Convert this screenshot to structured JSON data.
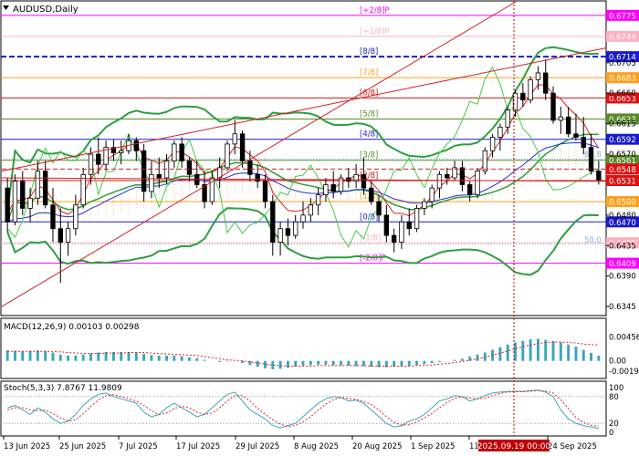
{
  "chart_data": {
    "type": "candlestick",
    "symbol_title": "AUDUSD,Daily",
    "ylim": [
      0.6333,
      0.6795
    ],
    "x_tick_labels": [
      "13 Jun 2025",
      "25 Jun 2025",
      "7 Jul 2025",
      "17 Jul 2025",
      "29 Jul 2025",
      "8 Aug 2025",
      "20 Aug 2025",
      "1 Sep 2025",
      "11 Sep 2025",
      "24 Sep 2025"
    ],
    "crosshair_label": "2025.09.19 00:00",
    "y_tick_labels": [
      {
        "text": "0.6705",
        "value": 0.6705
      },
      {
        "text": "0.6660",
        "value": 0.666
      },
      {
        "text": "0.6615",
        "value": 0.6615
      },
      {
        "text": "0.6570",
        "value": 0.657
      },
      {
        "text": "0.6480",
        "value": 0.648
      },
      {
        "text": "0.6435",
        "value": 0.6435
      },
      {
        "text": "0.6390",
        "value": 0.639
      },
      {
        "text": "0.6345",
        "value": 0.6345
      }
    ],
    "price_badges": [
      {
        "text": "0.6775",
        "value": 0.6775,
        "color": "#ff00ff"
      },
      {
        "text": "0.6744",
        "value": 0.6744,
        "color": "#ffb0c0"
      },
      {
        "text": "0.6714",
        "value": 0.6714,
        "color": "#1a1acc"
      },
      {
        "text": "0.6683",
        "value": 0.6683,
        "color": "#ff9f1a"
      },
      {
        "text": "0.6653",
        "value": 0.6653,
        "color": "#e01010"
      },
      {
        "text": "0.6622",
        "value": 0.6622,
        "color": "#5a8a2a"
      },
      {
        "text": "0.6592",
        "value": 0.6592,
        "color": "#1a1acc"
      },
      {
        "text": "0.6561",
        "value": 0.6561,
        "color": "#5a8a2a"
      },
      {
        "text": "0.6548",
        "value": 0.6548,
        "color": "#e01010"
      },
      {
        "text": "0.6531",
        "value": 0.6531,
        "color": "#e01010"
      },
      {
        "text": "0.6500",
        "value": 0.65,
        "color": "#ff9f1a"
      },
      {
        "text": "0.6470",
        "value": 0.647,
        "color": "#1a1acc"
      },
      {
        "text": "0.6439",
        "value": 0.6439,
        "color": "#ffb0c0"
      },
      {
        "text": "0.6409",
        "value": 0.6409,
        "color": "#ff00ff"
      }
    ],
    "murrey_levels": [
      {
        "label": "[+2/8]P",
        "value": 0.6775,
        "color": "#ff00ff"
      },
      {
        "label": "[+1/8]P",
        "value": 0.6744,
        "color": "#ffb0c0"
      },
      {
        "label": "[8/8]",
        "value": 0.6714,
        "color": "#1a1acc"
      },
      {
        "label": "[7/8]",
        "value": 0.6683,
        "color": "#ff9f1a"
      },
      {
        "label": "[6/8]",
        "value": 0.6653,
        "color": "#e01010"
      },
      {
        "label": "[5/8]",
        "value": 0.6622,
        "color": "#5a8a2a"
      },
      {
        "label": "[4/8]",
        "value": 0.6592,
        "color": "#1a1acc"
      },
      {
        "label": "[3/8]",
        "value": 0.6561,
        "color": "#5a8a2a"
      },
      {
        "label": "[2/8]",
        "value": 0.6531,
        "color": "#e01010"
      },
      {
        "label": "[1/8]",
        "value": 0.65,
        "color": "#ff9f1a"
      },
      {
        "label": "[0/8]",
        "value": 0.647,
        "color": "#1a1acc"
      },
      {
        "label": "[-1/8]",
        "value": 0.6439,
        "color": "#ffb0c0"
      },
      {
        "label": "[-2/8]P",
        "value": 0.6409,
        "color": "#ff00ff"
      }
    ],
    "fib_labels": [
      {
        "text": "61.8",
        "value": 0.6563
      },
      {
        "text": "50.0",
        "value": 0.6437
      }
    ],
    "candles": [
      [
        0.652,
        0.6535,
        0.6455,
        0.647
      ],
      [
        0.647,
        0.654,
        0.6465,
        0.653
      ],
      [
        0.653,
        0.6545,
        0.648,
        0.649
      ],
      [
        0.649,
        0.652,
        0.647,
        0.6505
      ],
      [
        0.6505,
        0.656,
        0.6495,
        0.6545
      ],
      [
        0.6545,
        0.656,
        0.649,
        0.6495
      ],
      [
        0.6495,
        0.652,
        0.644,
        0.646
      ],
      [
        0.646,
        0.649,
        0.638,
        0.644
      ],
      [
        0.644,
        0.647,
        0.642,
        0.646
      ],
      [
        0.646,
        0.651,
        0.645,
        0.6495
      ],
      [
        0.6495,
        0.655,
        0.649,
        0.654
      ],
      [
        0.654,
        0.658,
        0.6525,
        0.657
      ],
      [
        0.657,
        0.6595,
        0.654,
        0.6555
      ],
      [
        0.6555,
        0.659,
        0.6545,
        0.658
      ],
      [
        0.658,
        0.6592,
        0.656,
        0.6572
      ],
      [
        0.6572,
        0.659,
        0.6555,
        0.6575
      ],
      [
        0.6575,
        0.66,
        0.657,
        0.659
      ],
      [
        0.659,
        0.6595,
        0.656,
        0.6575
      ],
      [
        0.6575,
        0.6585,
        0.65,
        0.6515
      ],
      [
        0.6515,
        0.656,
        0.6505,
        0.654
      ],
      [
        0.654,
        0.6565,
        0.652,
        0.6535
      ],
      [
        0.6535,
        0.657,
        0.6525,
        0.656
      ],
      [
        0.656,
        0.659,
        0.655,
        0.6585
      ],
      [
        0.6585,
        0.6595,
        0.655,
        0.656
      ],
      [
        0.656,
        0.6565,
        0.653,
        0.654
      ],
      [
        0.654,
        0.656,
        0.652,
        0.6525
      ],
      [
        0.6525,
        0.6545,
        0.649,
        0.65
      ],
      [
        0.65,
        0.6545,
        0.6495,
        0.6535
      ],
      [
        0.6535,
        0.6565,
        0.652,
        0.655
      ],
      [
        0.655,
        0.659,
        0.6545,
        0.6585
      ],
      [
        0.6585,
        0.662,
        0.657,
        0.66
      ],
      [
        0.66,
        0.6605,
        0.655,
        0.656
      ],
      [
        0.656,
        0.6575,
        0.653,
        0.654
      ],
      [
        0.654,
        0.6555,
        0.652,
        0.653
      ],
      [
        0.653,
        0.654,
        0.649,
        0.65
      ],
      [
        0.65,
        0.651,
        0.642,
        0.644
      ],
      [
        0.644,
        0.647,
        0.642,
        0.646
      ],
      [
        0.646,
        0.6475,
        0.6435,
        0.645
      ],
      [
        0.645,
        0.648,
        0.6445,
        0.647
      ],
      [
        0.647,
        0.65,
        0.646,
        0.648
      ],
      [
        0.648,
        0.6505,
        0.647,
        0.6495
      ],
      [
        0.6495,
        0.652,
        0.648,
        0.651
      ],
      [
        0.651,
        0.6535,
        0.65,
        0.6525
      ],
      [
        0.6525,
        0.6545,
        0.6505,
        0.6515
      ],
      [
        0.6515,
        0.654,
        0.651,
        0.6535
      ],
      [
        0.6535,
        0.655,
        0.652,
        0.653
      ],
      [
        0.653,
        0.6555,
        0.652,
        0.654
      ],
      [
        0.654,
        0.6565,
        0.651,
        0.652
      ],
      [
        0.652,
        0.653,
        0.6495,
        0.65
      ],
      [
        0.65,
        0.651,
        0.647,
        0.648
      ],
      [
        0.648,
        0.6495,
        0.644,
        0.645
      ],
      [
        0.645,
        0.646,
        0.6425,
        0.644
      ],
      [
        0.644,
        0.648,
        0.643,
        0.647
      ],
      [
        0.647,
        0.649,
        0.645,
        0.646
      ],
      [
        0.646,
        0.6495,
        0.6455,
        0.649
      ],
      [
        0.649,
        0.6505,
        0.648,
        0.65
      ],
      [
        0.65,
        0.6525,
        0.649,
        0.652
      ],
      [
        0.652,
        0.6545,
        0.6505,
        0.654
      ],
      [
        0.654,
        0.655,
        0.6525,
        0.6535
      ],
      [
        0.6535,
        0.656,
        0.653,
        0.655
      ],
      [
        0.655,
        0.656,
        0.6515,
        0.6525
      ],
      [
        0.6525,
        0.653,
        0.65,
        0.651
      ],
      [
        0.651,
        0.655,
        0.6505,
        0.6545
      ],
      [
        0.6545,
        0.658,
        0.654,
        0.6575
      ],
      [
        0.6575,
        0.66,
        0.6565,
        0.6595
      ],
      [
        0.6595,
        0.6615,
        0.6575,
        0.661
      ],
      [
        0.661,
        0.664,
        0.66,
        0.6635
      ],
      [
        0.6635,
        0.6665,
        0.6625,
        0.666
      ],
      [
        0.666,
        0.6675,
        0.664,
        0.665
      ],
      [
        0.665,
        0.6685,
        0.6645,
        0.668
      ],
      [
        0.668,
        0.67,
        0.6665,
        0.669
      ],
      [
        0.669,
        0.671,
        0.665,
        0.666
      ],
      [
        0.666,
        0.667,
        0.6615,
        0.662
      ],
      [
        0.662,
        0.664,
        0.66,
        0.6625
      ],
      [
        0.6625,
        0.664,
        0.6595,
        0.66
      ],
      [
        0.66,
        0.663,
        0.659,
        0.6595
      ],
      [
        0.6595,
        0.6625,
        0.657,
        0.658
      ],
      [
        0.658,
        0.66,
        0.654,
        0.6545
      ],
      [
        0.6545,
        0.656,
        0.6525,
        0.6532
      ]
    ],
    "macd": {
      "label": "MACD(12,26,9) 0.00103 0.00298",
      "scale_labels": [
        {
          "text": "0.00456",
          "value": 0.00456
        },
        {
          "text": "0.00",
          "value": 0.0
        },
        {
          "text": "-0.00196",
          "value": -0.00196
        }
      ],
      "ylim": [
        -0.003,
        0.0055
      ],
      "hist": [
        0.002,
        0.0019,
        0.0018,
        0.0019,
        0.002,
        0.0019,
        0.0016,
        0.0012,
        0.001,
        0.001,
        0.0012,
        0.0014,
        0.0016,
        0.0017,
        0.0017,
        0.0017,
        0.0017,
        0.0016,
        0.0013,
        0.0011,
        0.001,
        0.001,
        0.001,
        0.0009,
        0.0007,
        0.0005,
        0.0002,
        0.0,
        -0.0002,
        -0.0001,
        0.0,
        -0.0004,
        -0.0008,
        -0.0011,
        -0.0014,
        -0.0016,
        -0.0015,
        -0.0013,
        -0.0011,
        -0.0009,
        -0.0008,
        -0.0007,
        -0.0007,
        -0.0008,
        -0.0008,
        -0.0009,
        -0.001,
        -0.001,
        -0.0011,
        -0.0012,
        -0.0012,
        -0.0011,
        -0.001,
        -0.0009,
        -0.0008,
        -0.0006,
        -0.0004,
        -0.0002,
        0.0,
        0.0002,
        0.0004,
        0.0008,
        0.0012,
        0.0016,
        0.0021,
        0.0026,
        0.0031,
        0.0035,
        0.0038,
        0.0041,
        0.0042,
        0.004,
        0.0038,
        0.0035,
        0.0031,
        0.0027,
        0.0021,
        0.0015,
        0.001
      ],
      "signal": [
        0.0018,
        0.0018,
        0.0018,
        0.0018,
        0.0018,
        0.0018,
        0.0018,
        0.0017,
        0.0016,
        0.0015,
        0.0014,
        0.0014,
        0.0014,
        0.0015,
        0.0015,
        0.0015,
        0.0016,
        0.0016,
        0.0016,
        0.0015,
        0.0014,
        0.0013,
        0.0012,
        0.0012,
        0.0011,
        0.001,
        0.0008,
        0.0006,
        0.0004,
        0.0002,
        0.0001,
        0.0,
        -0.0002,
        -0.0004,
        -0.0006,
        -0.0008,
        -0.0009,
        -0.001,
        -0.001,
        -0.001,
        -0.001,
        -0.0009,
        -0.0009,
        -0.0009,
        -0.0009,
        -0.0009,
        -0.0009,
        -0.0009,
        -0.001,
        -0.001,
        -0.001,
        -0.001,
        -0.001,
        -0.001,
        -0.0009,
        -0.0008,
        -0.0008,
        -0.0006,
        -0.0005,
        -0.0003,
        -0.0001,
        0.0001,
        0.0004,
        0.0007,
        0.0011,
        0.0015,
        0.0019,
        0.0023,
        0.0027,
        0.003,
        0.0033,
        0.0035,
        0.0036,
        0.0036,
        0.0035,
        0.0034,
        0.0032,
        0.0031,
        0.003
      ]
    },
    "stoch": {
      "label": "Stoch(5,3,3) 7.8767 11.9809",
      "scale_labels": [
        {
          "text": "100",
          "value": 100
        },
        {
          "text": "80",
          "value": 80
        },
        {
          "text": "20",
          "value": 20
        },
        {
          "text": "0",
          "value": 0
        }
      ],
      "ylim": [
        0,
        100
      ],
      "k": [
        55,
        60,
        50,
        40,
        55,
        45,
        30,
        20,
        25,
        40,
        60,
        75,
        85,
        88,
        80,
        75,
        70,
        65,
        45,
        35,
        40,
        55,
        65,
        55,
        45,
        35,
        40,
        55,
        70,
        85,
        90,
        70,
        50,
        40,
        30,
        15,
        10,
        15,
        20,
        35,
        50,
        65,
        75,
        80,
        78,
        70,
        72,
        65,
        50,
        35,
        20,
        12,
        15,
        25,
        30,
        40,
        55,
        70,
        75,
        82,
        80,
        70,
        75,
        82,
        88,
        90,
        91,
        92,
        91,
        93,
        94,
        90,
        80,
        50,
        30,
        20,
        15,
        12,
        8
      ],
      "d": [
        50,
        55,
        55,
        50,
        48,
        50,
        42,
        32,
        25,
        28,
        42,
        58,
        72,
        82,
        84,
        80,
        75,
        70,
        60,
        48,
        40,
        43,
        53,
        58,
        55,
        45,
        40,
        43,
        55,
        70,
        82,
        82,
        70,
        53,
        40,
        28,
        18,
        13,
        15,
        23,
        35,
        50,
        63,
        73,
        78,
        76,
        73,
        69,
        62,
        50,
        35,
        22,
        16,
        17,
        23,
        32,
        42,
        55,
        67,
        76,
        79,
        77,
        75,
        76,
        82,
        87,
        90,
        91,
        91,
        92,
        93,
        92,
        88,
        73,
        53,
        33,
        22,
        16,
        12
      ]
    }
  }
}
